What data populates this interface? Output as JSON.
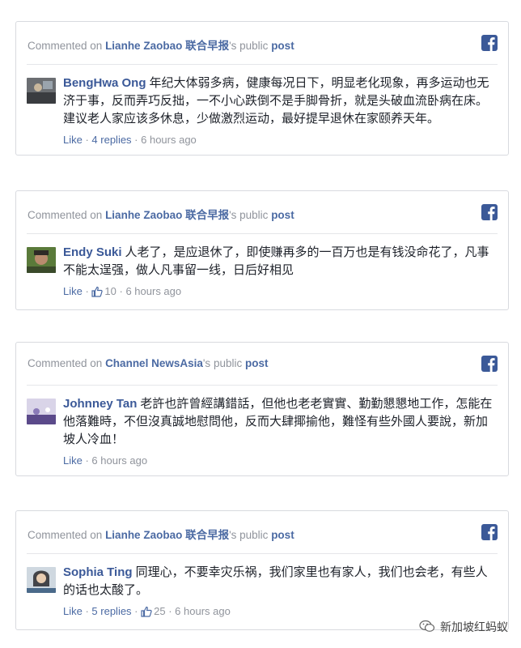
{
  "common": {
    "commented_on": "Commented on ",
    "public": "'s public ",
    "post": "post",
    "like": "Like",
    "dot": " · "
  },
  "cards": [
    {
      "page": "Lianhe Zaobao 联合早报",
      "author": "BengHwa Ong",
      "text": "年纪大体弱多病，健康每况日下，明显老化现象，再多运动也无济于事，反而弄巧反拙，一不小心跌倒不是手脚骨折，就是头破血流卧病在床。建议老人家应该多休息，少做激烈运动，最好提早退休在家颐养天年。",
      "replies": "4 replies",
      "likes": "",
      "time": "6 hours ago"
    },
    {
      "page": "Lianhe Zaobao 联合早报",
      "author": "Endy Suki",
      "text": "人老了，是应退休了，即使赚再多的一百万也是有钱没命花了，凡事不能太逞强，做人凡事留一线，日后好相见",
      "replies": "",
      "likes": "10",
      "time": "6 hours ago"
    },
    {
      "page": "Channel NewsAsia",
      "author": "Johnney Tan",
      "text": "老許也許曾經講錯話，但他也老老實實、勤勤懇懇地工作，怎能在他落難時，不但沒真誠地慰問他，反而大肆揶揄他，難怪有些外國人要說，新加坡人冷血！",
      "replies": "",
      "likes": "",
      "time": "6 hours ago"
    },
    {
      "page": "Lianhe Zaobao 联合早报",
      "author": "Sophia Ting",
      "text": "同理心，不要幸灾乐祸，我们家里也有家人，我们也会老，有些人的话也太酸了。",
      "replies": "5 replies",
      "likes": "25",
      "time": "6 hours ago"
    }
  ],
  "watermark": "新加坡红蚂蚁",
  "colors": {
    "fb_blue": "#3b5998",
    "link": "#4b6aa3",
    "meta": "#90949c"
  }
}
